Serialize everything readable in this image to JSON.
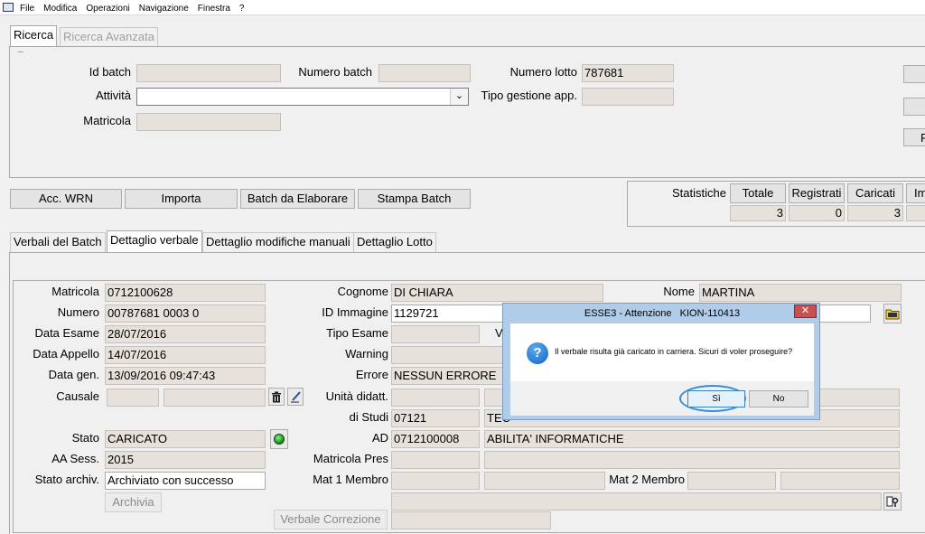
{
  "menu": [
    "File",
    "Modifica",
    "Operazioni",
    "Navigazione",
    "Finestra",
    "?"
  ],
  "search_tabs": {
    "basic": "Ricerca",
    "advanced": "Ricerca Avanzata"
  },
  "search": {
    "id_batch_label": "Id batch",
    "id_batch_value": "",
    "numero_batch_label": "Numero batch",
    "numero_batch_value": "",
    "numero_lotto_label": "Numero lotto",
    "numero_lotto_value": "787681",
    "attivita_label": "Attività",
    "attivita_value": "",
    "tipo_gestione_label": "Tipo gestione app.",
    "tipo_gestione_value": "",
    "matricola_label": "Matricola",
    "matricola_value": ""
  },
  "actions": [
    "Acc. WRN",
    "Importa",
    "Batch da Elaborare",
    "Stampa Batch"
  ],
  "stats": {
    "label": "Statistiche",
    "headers": [
      "Totale",
      "Registrati",
      "Caricati",
      "Im"
    ],
    "values": [
      "3",
      "0",
      "3",
      ""
    ]
  },
  "detail_tabs": [
    "Verbali del Batch",
    "Dettaglio verbale",
    "Dettaglio modifiche manuali",
    "Dettaglio Lotto"
  ],
  "detail": {
    "matricola_label": "Matricola",
    "matricola_value": "0712100628",
    "numero_label": "Numero",
    "numero_value": "00787681 0003 0",
    "data_esame_label": "Data Esame",
    "data_esame_value": "28/07/2016",
    "data_appello_label": "Data Appello",
    "data_appello_value": "14/07/2016",
    "data_gen_label": "Data gen.",
    "data_gen_value": "13/09/2016 09:47:43",
    "causale_label": "Causale",
    "stato_label": "Stato",
    "stato_value": "CARICATO",
    "aa_sess_label": "AA Sess.",
    "aa_sess_value": "2015",
    "stato_archiv_label": "Stato archiv.",
    "stato_archiv_value": "Archiviato con successo",
    "archivia_button": "Archivia",
    "cognome_label": "Cognome",
    "cognome_value": "DI CHIARA",
    "nome_label": "Nome",
    "nome_value": "MARTINA",
    "id_immagine_label": "ID Immagine",
    "id_immagine_value": "1129721",
    "tipo_esame_label": "Tipo Esame",
    "tipo_esame_extra": "V",
    "warning_label": "Warning",
    "errore_label": "Errore",
    "errore_value": "NESSUN ERRORE",
    "unita_didatt_label": "Unità didatt.",
    "di_studi_label": "di Studi",
    "di_studi_code": "07121",
    "di_studi_desc": "TEC",
    "ad_label": "AD",
    "ad_code": "0712100008",
    "ad_desc": "ABILITA' INFORMATICHE",
    "matricola_pres_label": "Matricola Pres",
    "mat1_label": "Mat 1 Membro",
    "mat2_label": "Mat 2 Membro",
    "verbale_correzione_button": "Verbale Correzione"
  },
  "dialog": {
    "title": "ESSE3 - Attenzione   KION-110413",
    "message": "Il verbale risulta già caricato in carriera. Sicuri di voler proseguire?",
    "yes": "Sì",
    "no": "No"
  },
  "colors": {
    "field_bg": "#e6e1da",
    "dialog_border": "#b0cce8",
    "close_red": "#c75050",
    "highlight": "#2f8fdc"
  }
}
